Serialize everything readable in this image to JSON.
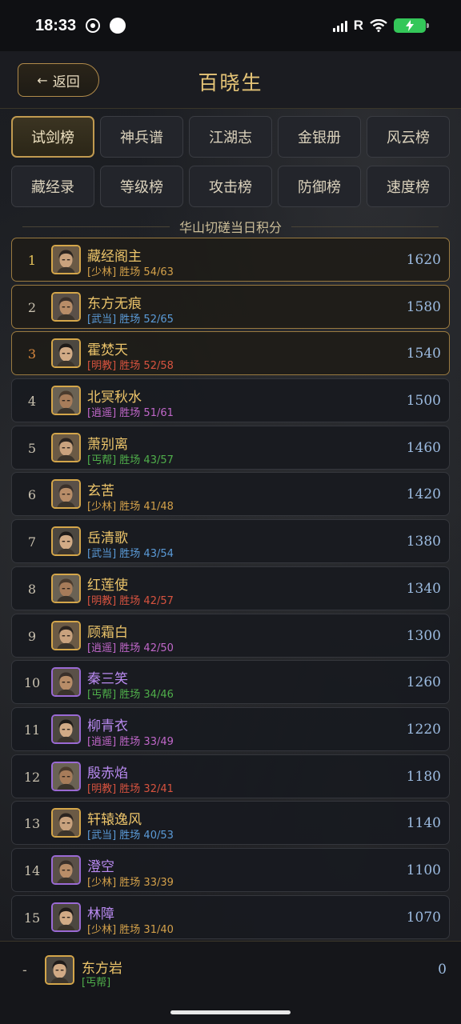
{
  "status_bar": {
    "time": "18:33",
    "carrier_indicator": "R"
  },
  "header": {
    "back_label": "返回",
    "title": "百晓生"
  },
  "tabs": [
    {
      "label": "试剑榜",
      "active": true
    },
    {
      "label": "神兵谱",
      "active": false
    },
    {
      "label": "江湖志",
      "active": false
    },
    {
      "label": "金银册",
      "active": false
    },
    {
      "label": "风云榜",
      "active": false
    },
    {
      "label": "藏经录",
      "active": false
    },
    {
      "label": "等级榜",
      "active": false
    },
    {
      "label": "攻击榜",
      "active": false
    },
    {
      "label": "防御榜",
      "active": false
    },
    {
      "label": "速度榜",
      "active": false
    }
  ],
  "section_title": "华山切磋当日积分",
  "faction_colors": {
    "少林": "#d4a14a",
    "武当": "#5b9bd8",
    "明教": "#d8533f",
    "逍遥": "#c067c9",
    "丐帮": "#4fae4a"
  },
  "rankings": [
    {
      "rank": "1",
      "name": "藏经阁主",
      "faction": "[少林]",
      "faction_key": "少林",
      "record": "胜场 54/63",
      "score": "1620",
      "frame": "gold",
      "highlight": true
    },
    {
      "rank": "2",
      "name": "东方无痕",
      "faction": "[武当]",
      "faction_key": "武当",
      "record": "胜场 52/65",
      "score": "1580",
      "frame": "gold",
      "highlight": true
    },
    {
      "rank": "3",
      "name": "霍焚天",
      "faction": "[明教]",
      "faction_key": "明教",
      "record": "胜场 52/58",
      "score": "1540",
      "frame": "gold",
      "highlight": true
    },
    {
      "rank": "4",
      "name": "北冥秋水",
      "faction": "[逍遥]",
      "faction_key": "逍遥",
      "record": "胜场 51/61",
      "score": "1500",
      "frame": "gold",
      "highlight": false
    },
    {
      "rank": "5",
      "name": "萧别离",
      "faction": "[丐帮]",
      "faction_key": "丐帮",
      "record": "胜场 43/57",
      "score": "1460",
      "frame": "gold",
      "highlight": false
    },
    {
      "rank": "6",
      "name": "玄苦",
      "faction": "[少林]",
      "faction_key": "少林",
      "record": "胜场 41/48",
      "score": "1420",
      "frame": "gold",
      "highlight": false
    },
    {
      "rank": "7",
      "name": "岳清歌",
      "faction": "[武当]",
      "faction_key": "武当",
      "record": "胜场 43/54",
      "score": "1380",
      "frame": "gold",
      "highlight": false
    },
    {
      "rank": "8",
      "name": "红莲使",
      "faction": "[明教]",
      "faction_key": "明教",
      "record": "胜场 42/57",
      "score": "1340",
      "frame": "gold",
      "highlight": false
    },
    {
      "rank": "9",
      "name": "顾霜白",
      "faction": "[逍遥]",
      "faction_key": "逍遥",
      "record": "胜场 42/50",
      "score": "1300",
      "frame": "gold",
      "highlight": false
    },
    {
      "rank": "10",
      "name": "秦三笑",
      "faction": "[丐帮]",
      "faction_key": "丐帮",
      "record": "胜场 34/46",
      "score": "1260",
      "frame": "purple",
      "highlight": false
    },
    {
      "rank": "11",
      "name": "柳青衣",
      "faction": "[逍遥]",
      "faction_key": "逍遥",
      "record": "胜场 33/49",
      "score": "1220",
      "frame": "purple",
      "highlight": false
    },
    {
      "rank": "12",
      "name": "殷赤焰",
      "faction": "[明教]",
      "faction_key": "明教",
      "record": "胜场 32/41",
      "score": "1180",
      "frame": "purple",
      "highlight": false
    },
    {
      "rank": "13",
      "name": "轩辕逸风",
      "faction": "[武当]",
      "faction_key": "武当",
      "record": "胜场 40/53",
      "score": "1140",
      "frame": "gold",
      "highlight": false
    },
    {
      "rank": "14",
      "name": "澄空",
      "faction": "[少林]",
      "faction_key": "少林",
      "record": "胜场 33/39",
      "score": "1100",
      "frame": "purple",
      "highlight": false
    },
    {
      "rank": "15",
      "name": "林障",
      "faction": "[少林]",
      "faction_key": "少林",
      "record": "胜场 31/40",
      "score": "1070",
      "frame": "purple",
      "highlight": false
    }
  ],
  "self": {
    "rank": "-",
    "name": "东方岩",
    "faction": "[丐帮]",
    "faction_key": "丐帮",
    "score": "0",
    "frame": "gold"
  }
}
